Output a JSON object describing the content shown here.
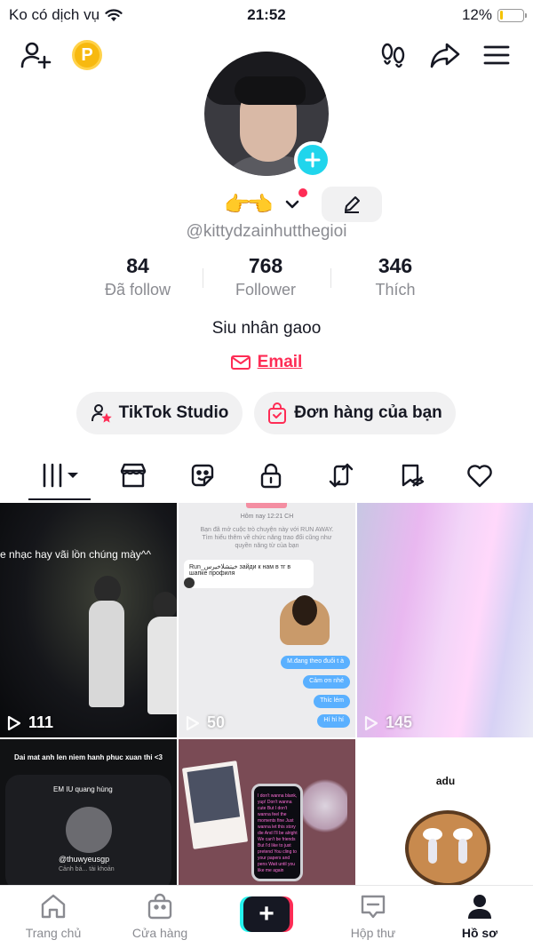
{
  "status_bar": {
    "carrier": "Ko có dịch vụ",
    "time": "21:52",
    "battery_text": "12%",
    "battery_level": 0.12
  },
  "top_nav": {
    "icons": [
      "add-friend-icon",
      "coin-icon",
      "footprints-icon",
      "share-icon",
      "menu-icon"
    ],
    "coin_letter": "P"
  },
  "profile": {
    "display_name": "👉👈",
    "handle": "@kittydzainhutthegioi",
    "bio": "Siu nhân gaoo",
    "email_label": "Email"
  },
  "stats": [
    {
      "value": "84",
      "label": "Đã follow"
    },
    {
      "value": "768",
      "label": "Follower"
    },
    {
      "value": "346",
      "label": "Thích"
    }
  ],
  "actions": {
    "studio": "TikTok Studio",
    "orders": "Đơn hàng của bạn"
  },
  "tabs": [
    "grid-icon",
    "shop-icon",
    "sticker-icon",
    "lock-icon",
    "repost-icon",
    "saved-icon",
    "heart-icon"
  ],
  "videos": [
    {
      "views": "111",
      "caption": "e nhạc hay vãi lồn chúng mày^^"
    },
    {
      "views": "50",
      "chat": {
        "timestamp": "Hôm nay 12:21 CH",
        "system": "Bạn đã mở cuộc trò chuyện này với RUN AWAY. Tìm hiểu thêm về chức năng trao đổi cũng như quyền năng từ của bạn",
        "incoming": "Run_خيتشلاخيرس зайди к нам в тг в шапке профиля",
        "bubbles": [
          "M.đang theo đuổi t à",
          "Cảm ơn nhé",
          "Thíc lém",
          "Hí hí hí"
        ]
      }
    },
    {
      "views": "145"
    },
    {
      "caption": "Dai mat anh len niem hanh phuc xuan thi <3",
      "card_title": "EM IU quang hùng",
      "card_handle": "@thuwyeusgp",
      "card_sub": "Cảnh bá... tài khoản"
    },
    {
      "phone_text": "I don't wanna blank, yup! Don't wanna cute But I don't wanna feel the moments fine Just wanna let this story die And I'll be alright We can't be friends But I'd like to just pretend You cling to your papers and pens Wait until you like me again"
    },
    {
      "caption": "adu"
    }
  ],
  "bottom_nav": [
    {
      "label": "Trang chủ",
      "icon": "home-icon"
    },
    {
      "label": "Cửa hàng",
      "icon": "shop-bag-icon"
    },
    {
      "label": "",
      "icon": "create-plus-icon"
    },
    {
      "label": "Hộp thư",
      "icon": "inbox-icon"
    },
    {
      "label": "Hồ sơ",
      "icon": "profile-icon"
    }
  ],
  "colors": {
    "accent": "#fe2c55",
    "cyan": "#25f4ee",
    "text": "#161823",
    "muted": "#8a8b91"
  }
}
